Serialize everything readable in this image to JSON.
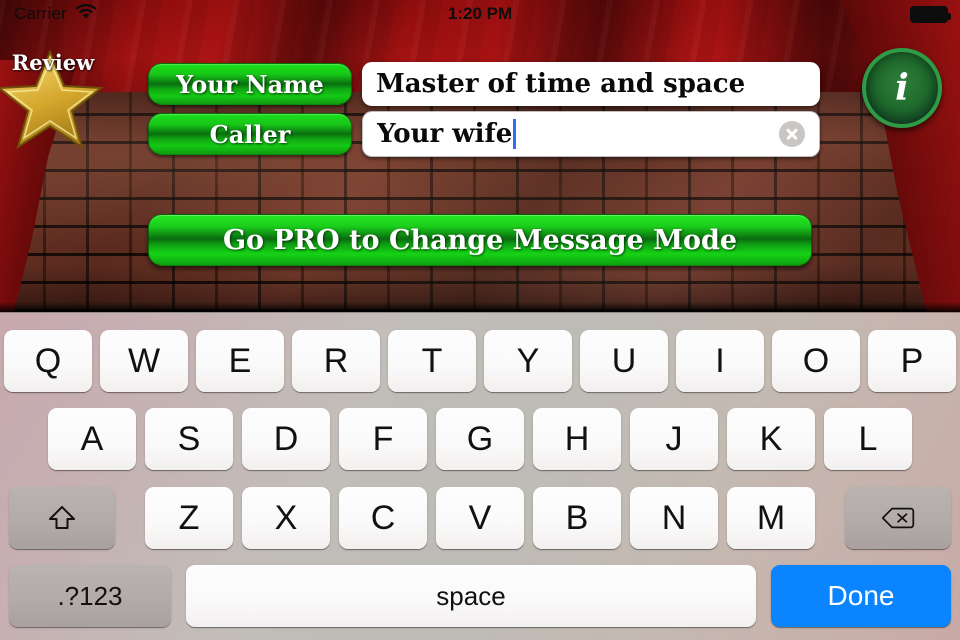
{
  "status_bar": {
    "carrier": "Carrier",
    "wifi_icon": "wifi-icon",
    "time": "1:20 PM",
    "battery_icon": "battery-full-icon"
  },
  "stage": {
    "background": "red-curtain-and-brick-wall",
    "curtain_color": "#8e0d0d",
    "brick_color": "#5c2b20"
  },
  "review_badge": {
    "label": "Review",
    "icon": "gold-star-icon",
    "star_color": "#e8c457"
  },
  "form": {
    "accent_green": "#17c617",
    "rows": [
      {
        "label": "Your Name",
        "value": "Master of time and space",
        "has_clear": false,
        "focused": false
      },
      {
        "label": "Caller",
        "value": "Your wife",
        "has_clear": true,
        "focused": true,
        "clear_icon": "clear-circle-x-icon"
      }
    ]
  },
  "info_button": {
    "glyph": "i",
    "icon": "info-icon",
    "color": "#1f6b2c",
    "ring_color": "#2f9b44"
  },
  "pro_button": {
    "label": "Go PRO to Change Message Mode"
  },
  "keyboard": {
    "background_color": "#c2bdb9",
    "row1": [
      "Q",
      "W",
      "E",
      "R",
      "T",
      "Y",
      "U",
      "I",
      "O",
      "P"
    ],
    "row2": [
      "A",
      "S",
      "D",
      "F",
      "G",
      "H",
      "J",
      "K",
      "L"
    ],
    "row3_letters": [
      "Z",
      "X",
      "C",
      "V",
      "B",
      "N",
      "M"
    ],
    "shift_key": {
      "label": "",
      "icon": "shift-arrow-icon"
    },
    "backspace_key": {
      "label": "",
      "icon": "backspace-delete-icon"
    },
    "numeric_key": {
      "label": ".?123"
    },
    "space_key": {
      "label": "space"
    },
    "done_key": {
      "label": "Done",
      "color": "#0a84ff"
    }
  }
}
